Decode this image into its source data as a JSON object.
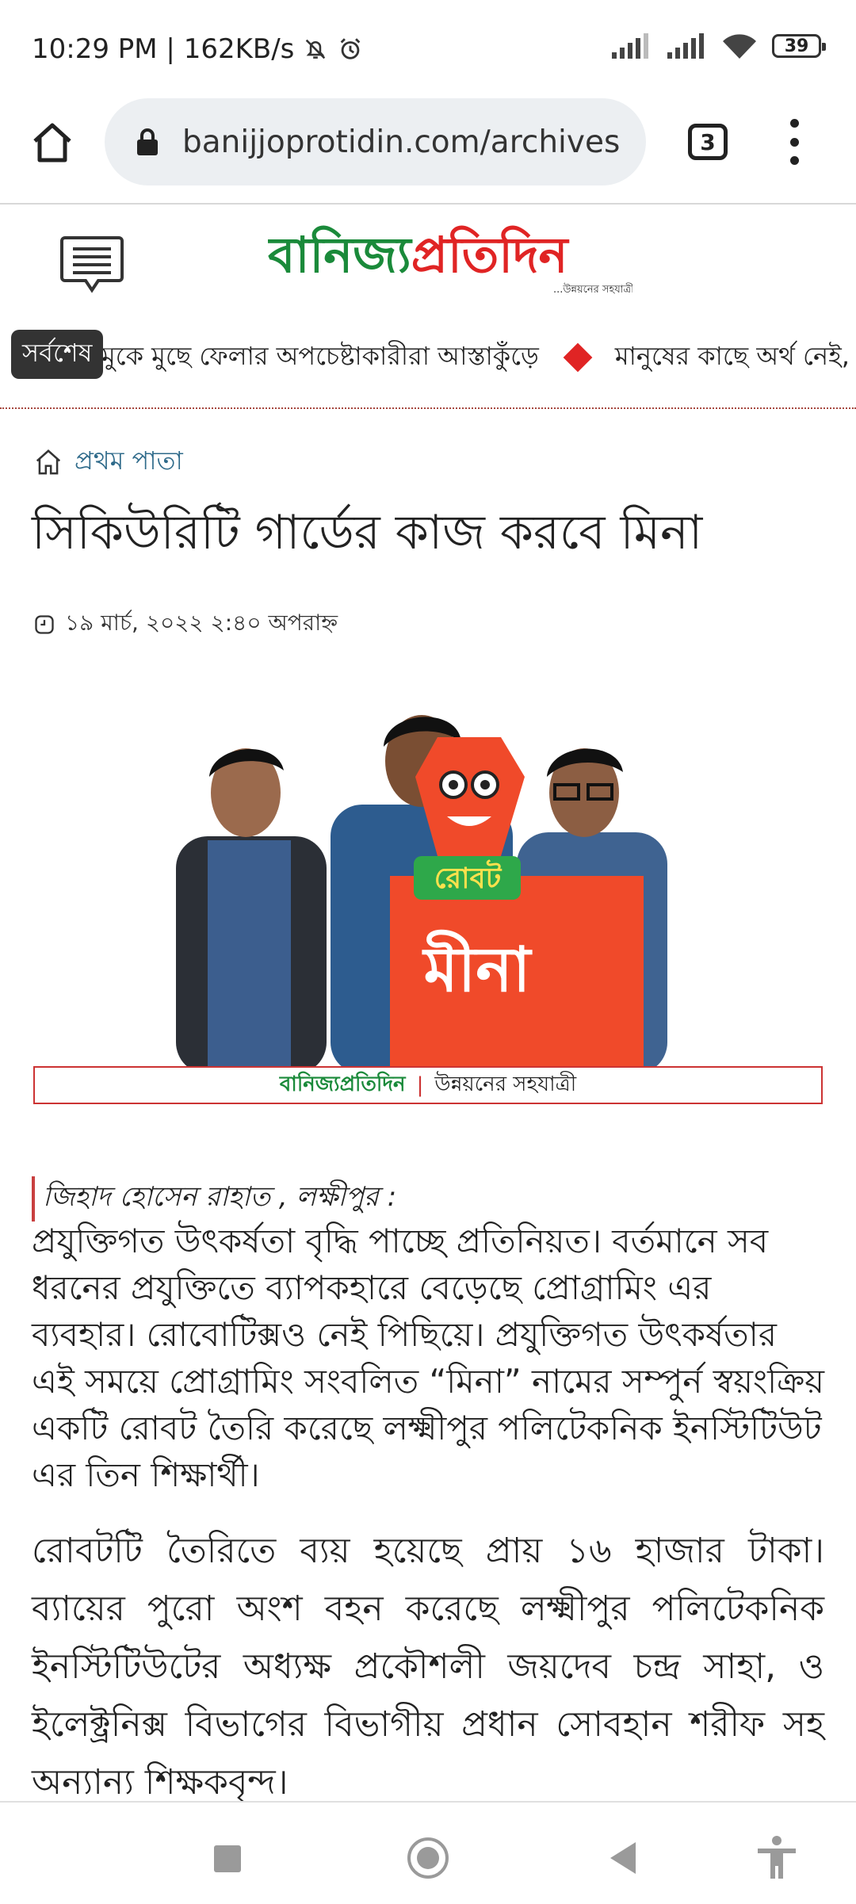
{
  "status_bar": {
    "time_speed": "10:29 PM | 162KB/s",
    "battery": "39"
  },
  "browser": {
    "url": "banijjoprotidin.com/archives",
    "tab_count": "3"
  },
  "site": {
    "logo_text": "বানিজ্যপ্রতিদিন",
    "logo_tagline": "...উন্নয়নের সহযাত্রী"
  },
  "ticker": {
    "badge": "সর্বশেষ",
    "items": [
      "মুকে মুছে ফেলার অপচেষ্টাকারীরা আস্তাকুঁড়ে",
      "মানুষের কাছে অর্থ নেই,"
    ]
  },
  "breadcrumb": {
    "label": "প্রথম পাতা"
  },
  "article": {
    "title": "সিকিউরিটি গার্ডের কাজ করবে মিনা",
    "date": "১৯ মার্চ, ২০২২ ২:৪০ অপরাহ্ন",
    "image": {
      "robot_label": "রোবট",
      "robot_name": "মীনা",
      "caption_brand": "বানিজ্যপ্রতিদিন",
      "caption_sep": "|",
      "caption_tag": "উন্নয়নের সহযাত্রী"
    },
    "byline": "জিহাদ হোসেন রাহাত , লক্ষীপুর :",
    "para1": "প্রযুক্তিগত উৎকর্ষতা বৃদ্ধি পাচ্ছে প্রতিনিয়ত। বর্তমানে সব ধরনের প্রযুক্তিতে ব্যাপকহারে বেড়েছে প্রোগ্রামিং এর ব্যবহার। রোবোটিক্সও নেই পিছিয়ে। প্রযুক্তিগত উৎকর্ষতার এই সময়ে প্রোগ্রামিং সংবলিত “মিনা” নামের সম্পুর্ন স্বয়ংক্রিয় একটি রোবট তৈরি করেছে লক্ষ্মীপুর পলিটেকনিক ইনস্টিটিউট এর তিন শিক্ষার্থী।",
    "para2": "রোবটটি তৈরিতে ব্যয় হয়েছে প্রায় ১৬ হাজার টাকা। ব্যায়ের পুরো অংশ বহন করেছে লক্ষ্মীপুর পলিটেকনিক ইনস্টিটিউটের অধ্যক্ষ প্রকৌশলী জয়দেব চন্দ্র সাহা, ও ইলেক্ট্রনিক্স বিভাগের বিভাগীয় প্রধান সোবহান শরীফ সহ অন্যান্য শিক্ষকবৃন্দ।"
  },
  "colors": {
    "brand_green": "#1a8a3a",
    "brand_red": "#e02424",
    "robot_red": "#f04a2a",
    "breadcrumb_blue": "#2e6a8a"
  }
}
